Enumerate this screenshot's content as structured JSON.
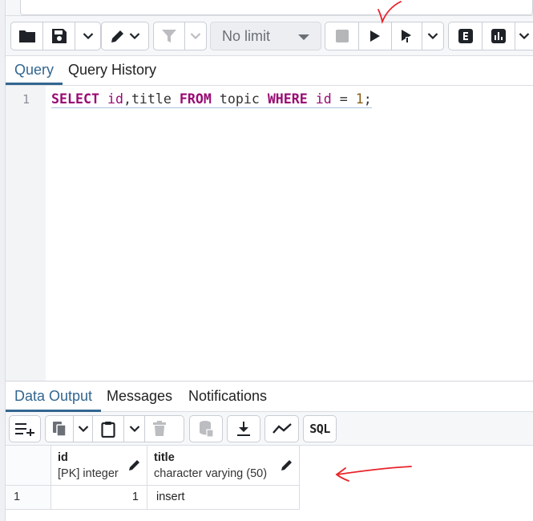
{
  "limit_select": {
    "value": "No limit"
  },
  "query_tabs": [
    {
      "label": "Query",
      "active": true
    },
    {
      "label": "Query History",
      "active": false
    }
  ],
  "editor": {
    "line_number": "1",
    "tokens": {
      "select": "SELECT",
      "col_id": "id",
      "comma": ",",
      "col_title": "title",
      "from": "FROM",
      "table": "topic",
      "where": "WHERE",
      "where_col": "id",
      "op": "=",
      "value": "1",
      "end": ";"
    }
  },
  "output_tabs": [
    {
      "label": "Data Output",
      "active": true
    },
    {
      "label": "Messages",
      "active": false
    },
    {
      "label": "Notifications",
      "active": false
    }
  ],
  "output_toolbar": {
    "sql_label": "SQL"
  },
  "grid": {
    "columns": [
      {
        "name": "id",
        "type": "[PK] integer"
      },
      {
        "name": "title",
        "type": "character varying (50)"
      }
    ],
    "rows": [
      {
        "row_number": "1",
        "id": "1",
        "title": "insert"
      }
    ]
  },
  "colors": {
    "accent": "#326690",
    "keyword": "#990a73",
    "annotation": "#e8232a"
  },
  "icons": [
    "folder-icon",
    "save-icon",
    "chevron-down-icon",
    "edit-icon",
    "filter-icon",
    "stop-icon",
    "execute-icon",
    "explain-icon",
    "explain-analyze-icon",
    "add-row-icon",
    "copy-icon",
    "paste-icon",
    "delete-icon",
    "save-data-icon",
    "download-icon",
    "graph-icon",
    "sql-icon"
  ]
}
